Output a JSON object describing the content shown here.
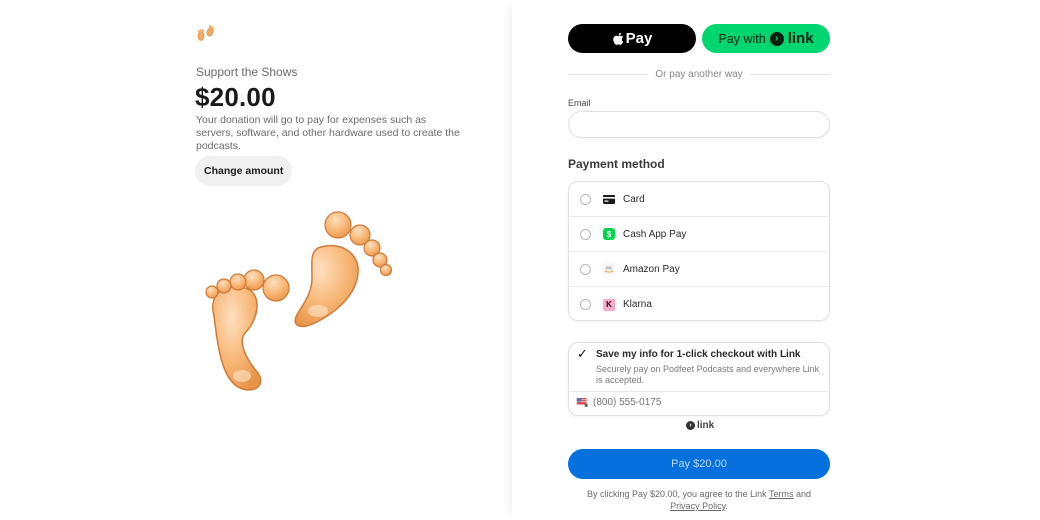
{
  "merchant": {
    "logo_icon": "footprints-icon"
  },
  "product": {
    "name": "Support the Shows",
    "price": "$20.00",
    "description": "Your donation will go to pay for expenses such as servers, software, and other hardware used to create the podcasts.",
    "change_amount_label": "Change amount",
    "hero_image": "footprints-illustration"
  },
  "wallets": {
    "apple_pay_label": "Pay",
    "link_pay_prefix": "Pay with",
    "link_pay_brand": "link"
  },
  "divider_text": "Or pay another way",
  "email": {
    "label": "Email",
    "value": "",
    "placeholder": ""
  },
  "payment_method": {
    "title": "Payment method",
    "options": [
      {
        "label": "Card",
        "icon": "credit-card-icon",
        "selected": false
      },
      {
        "label": "Cash App Pay",
        "icon": "cash-app-icon",
        "selected": false
      },
      {
        "label": "Amazon Pay",
        "icon": "amazon-pay-icon",
        "selected": false
      },
      {
        "label": "Klarna",
        "icon": "klarna-icon",
        "selected": false
      }
    ]
  },
  "link_save": {
    "checked": true,
    "title": "Save my info for 1-click checkout with Link",
    "description": "Securely pay on Podfeet Podcasts and everywhere Link is accepted.",
    "phone_placeholder": "(800) 555-0175",
    "country_flag": "us-flag-icon",
    "footer_brand": "link"
  },
  "pay_button_label": "Pay $20.00",
  "terms": {
    "prefix": "By clicking Pay $20.00, you agree to the Link ",
    "terms_link": "Terms",
    "middle": " and",
    "privacy_link": "Privacy Policy",
    "suffix": "."
  },
  "colors": {
    "pay_button": "#0570de",
    "link_green": "#00d66f",
    "apple_pay": "#000000",
    "cash_app": "#00d64f",
    "klarna": "#ffa8cd"
  }
}
